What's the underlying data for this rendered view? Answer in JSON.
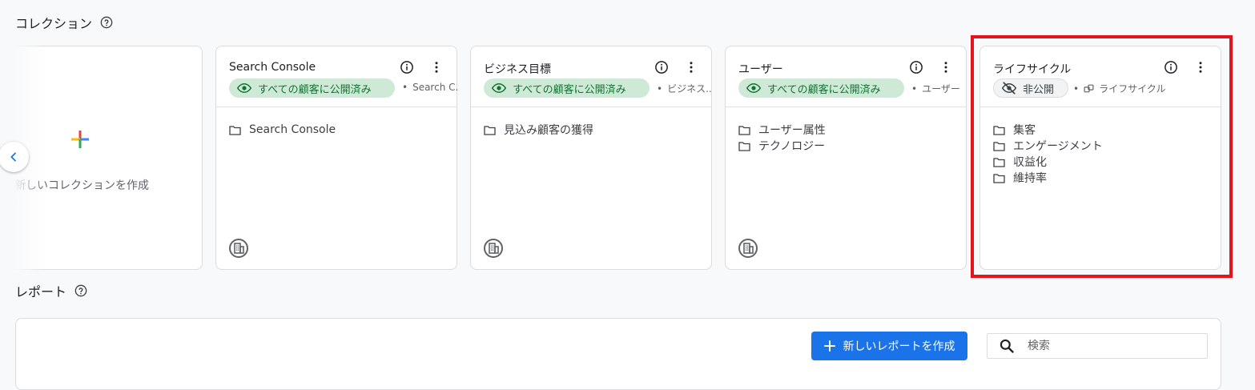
{
  "collections": {
    "title": "コレクション",
    "new_card_label": "新しいコレクションを作成",
    "cards": [
      {
        "title": "Search Console",
        "visibility": "すべての顧客に公開済み",
        "meta": "Search C...",
        "meta_icon": "",
        "folders": [
          "Search Console"
        ]
      },
      {
        "title": "ビジネス目標",
        "visibility": "すべての顧客に公開済み",
        "meta": "ビジネス...",
        "meta_icon": "",
        "folders": [
          "見込み顧客の獲得"
        ]
      },
      {
        "title": "ユーザー",
        "visibility": "すべての顧客に公開済み",
        "meta": "ユーザー",
        "meta_icon": "",
        "folders": [
          "ユーザー属性",
          "テクノロジー"
        ]
      },
      {
        "title": "ライフサイクル",
        "visibility": "非公開",
        "meta": "ライフサイクル",
        "meta_icon": "link-icon",
        "folders": [
          "集客",
          "エンゲージメント",
          "収益化",
          "維持率"
        ]
      }
    ]
  },
  "reports": {
    "title": "レポート",
    "new_report_label": "新しいレポートを作成",
    "search_placeholder": "検索"
  },
  "colors": {
    "accent_blue": "#1a73e8",
    "published_green_bg": "#ceead6",
    "published_green_text": "#137333",
    "highlight_red": "#e3141b"
  }
}
